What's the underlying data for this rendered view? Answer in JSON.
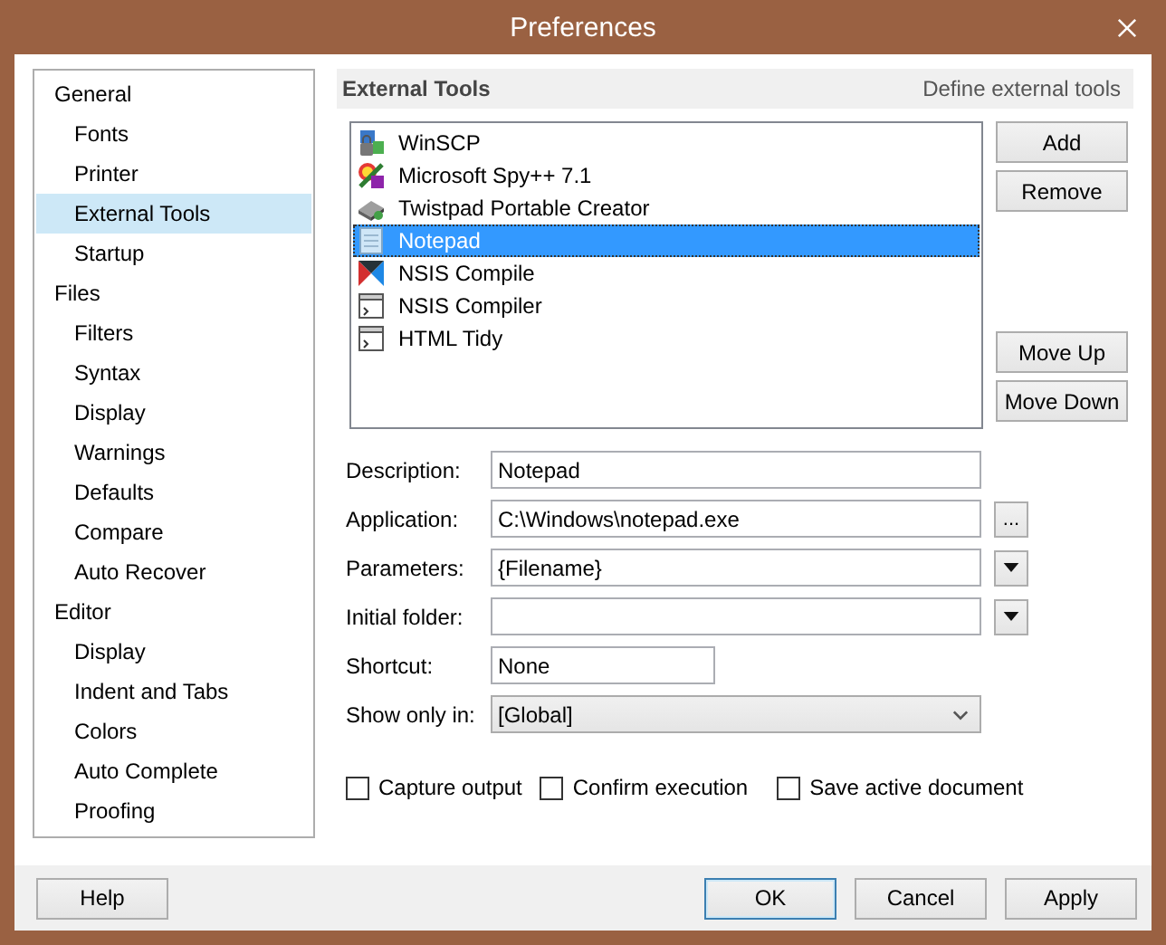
{
  "window": {
    "title": "Preferences"
  },
  "sidebar": {
    "items": [
      {
        "label": "General",
        "selected": false,
        "children": [
          {
            "label": "Fonts",
            "selected": false
          },
          {
            "label": "Printer",
            "selected": false
          },
          {
            "label": "External Tools",
            "selected": true
          },
          {
            "label": "Startup",
            "selected": false
          }
        ]
      },
      {
        "label": "Files",
        "selected": false,
        "children": [
          {
            "label": "Filters",
            "selected": false
          },
          {
            "label": "Syntax",
            "selected": false
          },
          {
            "label": "Display",
            "selected": false
          },
          {
            "label": "Warnings",
            "selected": false
          },
          {
            "label": "Defaults",
            "selected": false
          },
          {
            "label": "Compare",
            "selected": false
          },
          {
            "label": "Auto Recover",
            "selected": false
          }
        ]
      },
      {
        "label": "Editor",
        "selected": false,
        "children": [
          {
            "label": "Display",
            "selected": false
          },
          {
            "label": "Indent and Tabs",
            "selected": false
          },
          {
            "label": "Colors",
            "selected": false
          },
          {
            "label": "Auto Complete",
            "selected": false
          },
          {
            "label": "Proofing",
            "selected": false
          }
        ]
      }
    ]
  },
  "section": {
    "title": "External Tools",
    "subtitle": "Define external tools"
  },
  "tools": [
    {
      "label": "WinSCP",
      "selected": false
    },
    {
      "label": "Microsoft Spy++ 7.1",
      "selected": false
    },
    {
      "label": "Twistpad Portable Creator",
      "selected": false
    },
    {
      "label": "Notepad",
      "selected": true
    },
    {
      "label": "NSIS Compile",
      "selected": false
    },
    {
      "label": "NSIS Compiler",
      "selected": false
    },
    {
      "label": "HTML Tidy",
      "selected": false
    }
  ],
  "tool_buttons": {
    "top": [
      "Add",
      "Remove"
    ],
    "bottom": [
      "Move Up",
      "Move Down"
    ]
  },
  "fields": [
    {
      "label": "Description:",
      "kind": "text",
      "value": "Notepad"
    },
    {
      "label": "Application:",
      "kind": "browse",
      "value": "C:\\Windows\\notepad.exe",
      "button": "..."
    },
    {
      "label": "Parameters:",
      "kind": "menu",
      "value": "{Filename}"
    },
    {
      "label": "Initial folder:",
      "kind": "menu"
    },
    {
      "label": "Shortcut:",
      "kind": "short",
      "value": "None"
    },
    {
      "label": "Show only in:",
      "kind": "combo",
      "value": "[Global]"
    }
  ],
  "options": [
    {
      "label": "Capture output",
      "checked": false
    },
    {
      "label": "Confirm execution",
      "checked": false
    },
    {
      "label": "Save active document",
      "checked": false
    }
  ],
  "footer": {
    "left": [
      {
        "label": "Help",
        "default": false
      }
    ],
    "right": [
      {
        "label": "OK",
        "default": true
      },
      {
        "label": "Cancel",
        "default": false
      },
      {
        "label": "Apply",
        "default": false
      }
    ]
  }
}
